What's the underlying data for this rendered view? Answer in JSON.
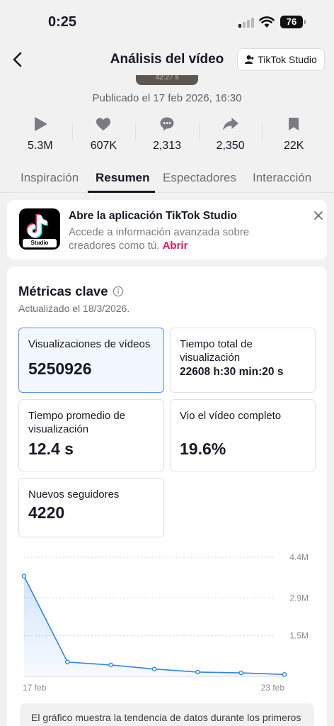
{
  "status": {
    "time": "0:25",
    "battery": "76"
  },
  "nav": {
    "title": "Análisis del vídeo",
    "studio_button": "TikTok Studio"
  },
  "thumb_time": "42:27 s",
  "published": "Publicado el 17 feb 2026, 16:30",
  "stats": [
    {
      "icon": "play-icon",
      "value": "5.3M"
    },
    {
      "icon": "heart-icon",
      "value": "607K"
    },
    {
      "icon": "comment-icon",
      "value": "2,313"
    },
    {
      "icon": "share-icon",
      "value": "2,350"
    },
    {
      "icon": "bookmark-icon",
      "value": "22K"
    }
  ],
  "tabs": [
    "Inspiración",
    "Resumen",
    "Espectadores",
    "Interacción"
  ],
  "active_tab": "Resumen",
  "promo": {
    "title": "Abre la aplicación TikTok Studio",
    "description": "Accede a información avanzada sobre creadores como tú.",
    "link": "Abrir",
    "icon_label": "Studio"
  },
  "metrics": {
    "title": "Métricas clave",
    "updated": "Actualizado el 18/3/2026.",
    "cards": [
      {
        "label": "Visualizaciones de vídeos",
        "value": "5250926",
        "selected": true
      },
      {
        "label": "Tiempo total de visualización",
        "value": "22608 h:30 min:20 s",
        "selected": false
      },
      {
        "label": "Tiempo promedio de visualización",
        "value": "12.4 s",
        "selected": false
      },
      {
        "label": "Vio el vídeo completo",
        "value": "19.6%",
        "selected": false
      },
      {
        "label": "Nuevos seguidores",
        "value": "4220",
        "selected": false
      }
    ]
  },
  "chart_data": {
    "type": "area",
    "x": [
      "17 feb",
      "18 feb",
      "19 feb",
      "20 feb",
      "21 feb",
      "22 feb",
      "23 feb"
    ],
    "values": [
      3700000,
      530000,
      420000,
      270000,
      160000,
      130000,
      70000
    ],
    "ylim": [
      0,
      4400000
    ],
    "y_ticks": [
      "4.4M",
      "2.9M",
      "1.5M"
    ],
    "x_tick_labels": [
      "17 feb",
      "23 feb"
    ],
    "color": "#2f86e8",
    "grid": true
  },
  "note": "El gráfico muestra la tendencia de datos durante los primeros"
}
